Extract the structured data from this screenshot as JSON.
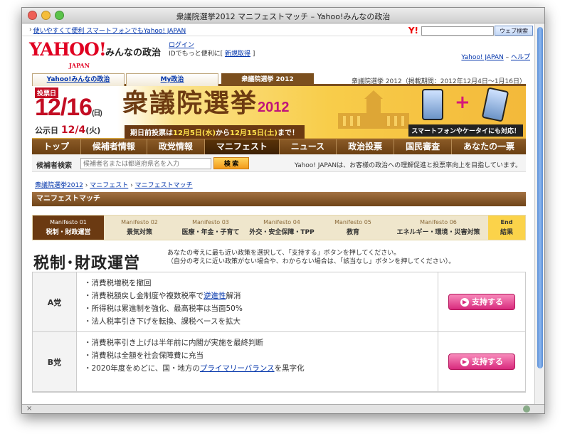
{
  "window": {
    "title": "衆議院選挙2012 マニフェストマッチ – Yahoo!みんなの政治"
  },
  "topstrip": {
    "arrow": "›",
    "link": "使いやすくて便利 スマートフォンでもYahoo! JAPAN"
  },
  "ysearch": {
    "mark": "Y!",
    "button": "ウェブ検索",
    "placeholder": ""
  },
  "header": {
    "logo": "YAHOO!",
    "logo_sub": "JAPAN",
    "site_name": "みんなの政治",
    "login_link": "ログイン",
    "login_text": "IDでもっと便利に",
    "signup_link": "新規取得",
    "yahoo_link": "Yahoo! JAPAN",
    "help_link": "ヘルプ"
  },
  "tabs": [
    {
      "label": "Yahoo!みんなの政治",
      "active": false
    },
    {
      "label": "My政治",
      "active": false
    },
    {
      "label": "衆議院選挙 2012",
      "active": true
    }
  ],
  "tab_info": "衆議院選挙 2012（掲載期間：2012年12月4日〜1月16日）",
  "banner": {
    "vote_label": "投票日",
    "vote_date": "12/16",
    "vote_day": "(日)",
    "announce_label": "公示日",
    "announce_date": "12/4",
    "announce_day": "(火)",
    "title": "衆議院選挙",
    "year": "2012",
    "early_vote_prefix": "期日前投票は",
    "early_vote_start": "12月5日(水)",
    "early_vote_mid": "から",
    "early_vote_end": "12月15日(土)",
    "early_vote_suffix": "まで！",
    "mobile_badge": "スマートフォンやケータイにも対応！",
    "plus": "+"
  },
  "nav": [
    "トップ",
    "候補者情報",
    "政党情報",
    "マニフェスト",
    "ニュース",
    "政治投票",
    "国民審査",
    "あなたの一票"
  ],
  "nav_active": "マニフェスト",
  "candidate_search": {
    "label": "候補者検索",
    "placeholder": "候補者名または都道府県名を入力",
    "button": "検 索",
    "message": "Yahoo! JAPANは、お客様の政治への理解促進と投票率向上を目指しています。"
  },
  "breadcrumb": [
    "衆議院選挙2012",
    "マニフェスト",
    "マニフェストマッチ"
  ],
  "breadcrumb_sep": "›",
  "section_title": "マニフェストマッチ",
  "steps": [
    {
      "num": "Manifesto 01",
      "label": "税制・財政運営"
    },
    {
      "num": "Manifesto 02",
      "label": "景気対策"
    },
    {
      "num": "Manifesto 03",
      "label": "医療・年金・子育て"
    },
    {
      "num": "Manifesto 04",
      "label": "外交・安全保障・TPP"
    },
    {
      "num": "Manifesto 05",
      "label": "教育"
    },
    {
      "num": "Manifesto 06",
      "label": "エネルギー・環境・災害対策"
    },
    {
      "num": "End",
      "label": "結果"
    }
  ],
  "theme": {
    "title": "税制･財政運営",
    "instruction1": "あなたの考えに最も近い政策を選択して、「支持する」ボタンを押してください。",
    "instruction2": "（自分の考えに近い政策がない場合や、わからない場合は、「該当なし」ボタンを押してください）。"
  },
  "parties": [
    {
      "name": "A党",
      "lines": [
        {
          "pre": "・消費税増税を撤回",
          "link": "",
          "post": ""
        },
        {
          "pre": "・消費税額戻し金制度や複数税率で",
          "link": "逆進性",
          "post": "解消"
        },
        {
          "pre": "・所得税は累進制を強化、最高税率は当面50%",
          "link": "",
          "post": ""
        },
        {
          "pre": "・法人税率引き下げを転換、課税ベースを拡大",
          "link": "",
          "post": ""
        }
      ],
      "button": "支持する"
    },
    {
      "name": "B党",
      "lines": [
        {
          "pre": "・消費税率引き上げは半年前に内閣が実施を最終判断",
          "link": "",
          "post": ""
        },
        {
          "pre": "・消費税は全額を社会保障費に充当",
          "link": "",
          "post": ""
        },
        {
          "pre": "・2020年度をめどに、国・地方の",
          "link": "プライマリーバランス",
          "post": "を黒字化"
        }
      ],
      "button": "支持する"
    }
  ],
  "statusbar": {
    "close": "⨯"
  },
  "colors": {
    "brand": "#7b4f1e",
    "accent": "#d82a7c",
    "yahoo_red": "#e00021"
  }
}
